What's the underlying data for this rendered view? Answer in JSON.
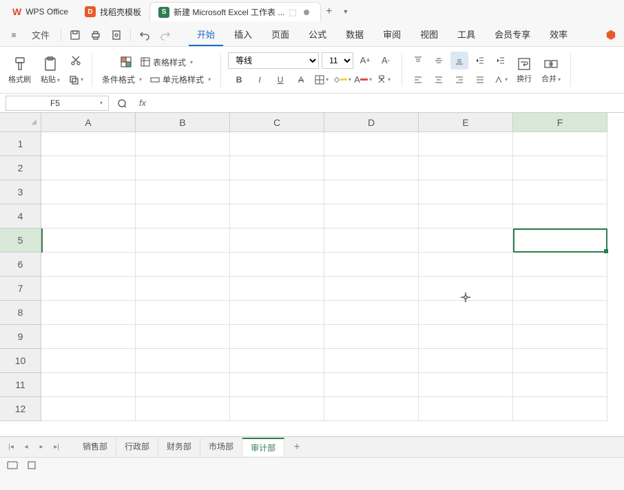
{
  "titlebar": {
    "tabs": [
      {
        "label": "WPS Office"
      },
      {
        "label": "找稻壳模板"
      },
      {
        "label": "新建 Microsoft Excel 工作表 ..."
      }
    ]
  },
  "menu": {
    "file": "文件",
    "tabs": [
      "开始",
      "插入",
      "页面",
      "公式",
      "数据",
      "审阅",
      "视图",
      "工具",
      "会员专享",
      "效率"
    ]
  },
  "ribbon": {
    "format_brush": "格式刷",
    "paste": "粘贴",
    "cond_format": "条件格式",
    "table_style": "表格样式",
    "cell_style": "单元格样式",
    "font_name": "等线",
    "font_size": "11",
    "wrap": "换行",
    "merge": "合并"
  },
  "namebox": "F5",
  "columns": [
    "A",
    "B",
    "C",
    "D",
    "E",
    "F"
  ],
  "rows": [
    "1",
    "2",
    "3",
    "4",
    "5",
    "6",
    "7",
    "8",
    "9",
    "10",
    "11",
    "12"
  ],
  "sheets": [
    "销售部",
    "行政部",
    "财务部",
    "市场部",
    "审计部"
  ],
  "active_sheet": 4,
  "active_col": 5,
  "active_row": 4
}
